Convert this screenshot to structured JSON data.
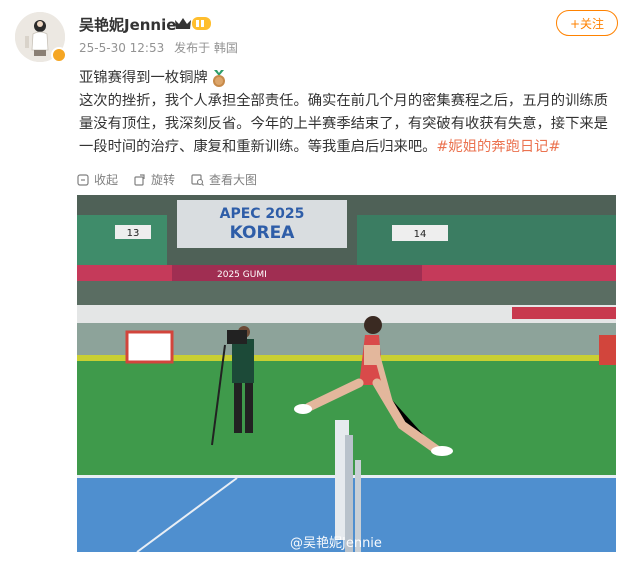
{
  "user": {
    "name": "吴艳妮Jennie"
  },
  "post": {
    "date": "25-5-30 12:53",
    "source": "发布于 韩国",
    "title": "亚锦赛得到一枚铜牌",
    "body": "这次的挫折，我个人承担全部责任。确实在前几个月的密集赛程之后，五月的训练质量没有顶住，我深刻反省。今年的上半赛季结束了，有突破有收获有失意，接下来是一段时间的治疗、康复和重新训练。等我重启后归来吧。",
    "hashtag": "#妮姐的奔跑日记#"
  },
  "follow_label": "+关注",
  "actions": {
    "collect": "收起",
    "rotate": "旋转",
    "view_large": "查看大图"
  },
  "photo": {
    "banner_text": "APEC 2025",
    "banner_text2": "KOREA",
    "ad_text": "2025 GUMI",
    "section_left": "13",
    "section_right": "14",
    "watermark": "@吴艳妮Jennie"
  },
  "colors": {
    "accent": "#ff8200",
    "hashtag": "#eb7350",
    "meta": "#939393"
  }
}
